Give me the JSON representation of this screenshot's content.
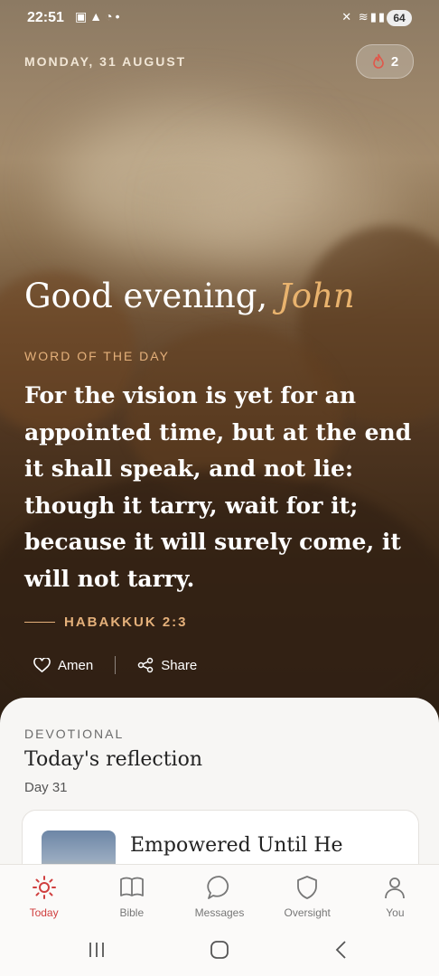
{
  "status_bar": {
    "time": "22:51",
    "battery": "64",
    "left_icons": [
      "screenshot-icon",
      "alert-icon",
      "whatsapp-icon",
      "dot-icon"
    ],
    "right_icons": [
      "mute-icon",
      "wifi-icon",
      "signal-icon",
      "signal-icon"
    ]
  },
  "header": {
    "date": "MONDAY, 31 AUGUST",
    "streak_count": "2",
    "streak_icon": "flame-icon"
  },
  "greeting": {
    "prefix": "Good evening,",
    "name": "John"
  },
  "word_of_day": {
    "label": "WORD OF THE DAY",
    "verse": "For the vision is yet for an appointed time, but at the end it shall speak, and not lie: though it tarry, wait for it; because it will surely come, it will not tarry.",
    "reference": "HABAKKUK 2:3",
    "actions": [
      {
        "label": "Amen",
        "icon": "heart-icon"
      },
      {
        "label": "Share",
        "icon": "share-icon"
      }
    ]
  },
  "devotional": {
    "label": "DEVOTIONAL",
    "title": "Today's reflection",
    "day": "Day 31",
    "card_title": "Empowered Until He"
  },
  "tabs": [
    {
      "label": "Today",
      "icon": "sun-icon",
      "active": true
    },
    {
      "label": "Bible",
      "icon": "book-icon",
      "active": false
    },
    {
      "label": "Messages",
      "icon": "chat-icon",
      "active": false
    },
    {
      "label": "Oversight",
      "icon": "shield-icon",
      "active": false
    },
    {
      "label": "You",
      "icon": "person-icon",
      "active": false
    }
  ],
  "colors": {
    "accent": "#d03f3f",
    "gold": "#e4b07a",
    "name": "#e9b36e"
  }
}
